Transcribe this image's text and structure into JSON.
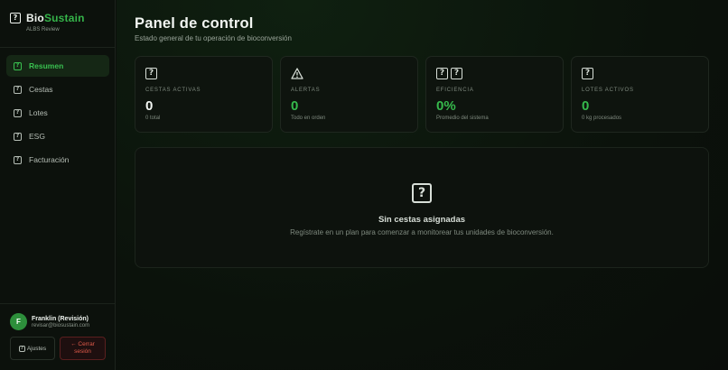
{
  "brand": {
    "name_part1": "Bio",
    "name_part2": "Sustain",
    "subtitle": "ALBS Review",
    "accent": "#35b44a"
  },
  "sidebar": {
    "items": [
      {
        "label": "Resumen",
        "icon": "question-box-icon",
        "active": true
      },
      {
        "label": "Cestas",
        "icon": "question-box-icon",
        "active": false
      },
      {
        "label": "Lotes",
        "icon": "question-box-icon",
        "active": false
      },
      {
        "label": "ESG",
        "icon": "question-box-icon",
        "active": false
      },
      {
        "label": "Facturación",
        "icon": "question-box-icon",
        "active": false
      }
    ]
  },
  "user": {
    "initial": "F",
    "name": "Franklin (Revisión)",
    "email": "revisar@biosustain.com",
    "settings_label": "Ajustes",
    "logout_label": "← Cerrar sesión"
  },
  "header": {
    "title": "Panel de control",
    "subtitle": "Estado general de tu operación de bioconversión"
  },
  "stats": [
    {
      "label": "CESTAS ACTIVAS",
      "value": "0",
      "note": "0 total",
      "icon": "question-box-icon",
      "value_color": "#f2f6f2"
    },
    {
      "label": "ALERTAS",
      "value": "0",
      "note": "Todo en orden",
      "icon": "warning-icon",
      "value_color": "#36b94c"
    },
    {
      "label": "EFICIENCIA",
      "value": "0%",
      "note": "Promedio del sistema",
      "icon": "question-box-icon",
      "value_color": "#36b94c"
    },
    {
      "label": "LOTES ACTIVOS",
      "value": "0",
      "note": "0 kg procesados",
      "icon": "question-box-icon",
      "value_color": "#36b94c"
    }
  ],
  "empty_state": {
    "title": "Sin cestas asignadas",
    "text": "Regístrate en un plan para comenzar a monitorear tus unidades de bioconversión."
  }
}
